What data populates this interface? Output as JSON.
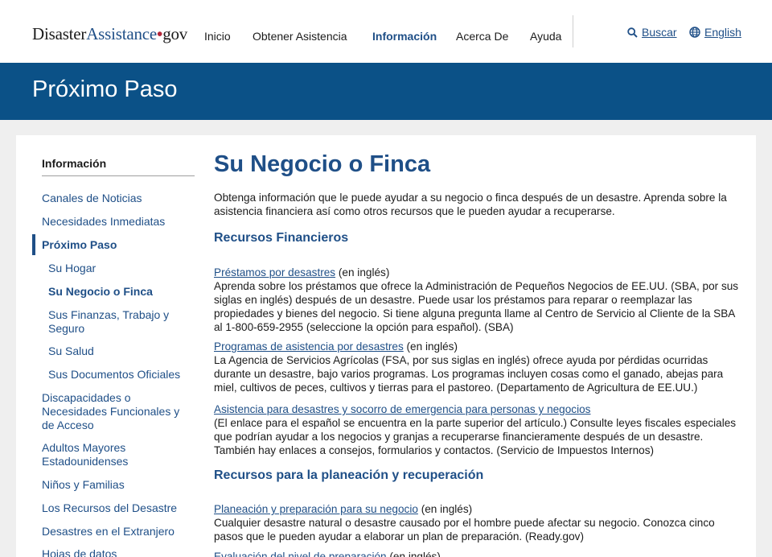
{
  "header": {
    "logo": {
      "part1": "Disaster",
      "part2": "Assistance",
      "part3": "gov"
    },
    "nav": [
      "Inicio",
      "Obtener Asistencia",
      "Información",
      "Acerca De",
      "Ayuda"
    ],
    "search_label": "Buscar",
    "language_label": "English"
  },
  "banner": {
    "title": "Próximo Paso"
  },
  "sidebar": {
    "title": "Información",
    "items": [
      {
        "label": "Canales de Noticias"
      },
      {
        "label": "Necesidades Inmediatas"
      },
      {
        "label": "Próximo Paso"
      },
      {
        "label": "Su Hogar"
      },
      {
        "label": "Su Negocio o Finca"
      },
      {
        "label": "Sus Finanzas, Trabajo y Seguro"
      },
      {
        "label": "Su Salud"
      },
      {
        "label": "Sus Documentos Oficiales"
      },
      {
        "label": "Discapacidades o Necesidades Funcionales y de Acceso"
      },
      {
        "label": "Adultos Mayores Estadounidenses"
      },
      {
        "label": "Niños y Familias"
      },
      {
        "label": "Los Recursos del Desastre"
      },
      {
        "label": "Desastres en el Extranjero"
      },
      {
        "label": "Hojas de datos"
      }
    ]
  },
  "main": {
    "title": "Su Negocio o Finca",
    "intro": "Obtenga información que le puede ayudar a su negocio o finca después de un desastre. Aprenda sobre la asistencia financiera así como otros recursos que le pueden ayudar a recuperarse.",
    "sections": [
      {
        "heading": "Recursos Financieros",
        "entries": [
          {
            "link": "Préstamos por desastres",
            "suffix": " (en inglés)",
            "text": "Aprenda sobre los préstamos que ofrece la Administración de Pequeños Negocios de EE.UU. (SBA, por sus siglas en inglés) después de un desastre. Puede usar los préstamos para reparar o reemplazar las propiedades y bienes del negocio. Si tiene alguna pregunta llame al Centro de Servicio al Cliente de la SBA al 1-800-659-2955 (seleccione la opción para español). (SBA)"
          },
          {
            "link": "Programas de asistencia por desastres",
            "suffix": " (en inglés)",
            "text": "La Agencia de Servicios Agrícolas (FSA, por sus siglas en inglés) ofrece ayuda por pérdidas ocurridas durante un desastre, bajo varios programas. Los programas incluyen cosas como el ganado, abejas para miel, cultivos de peces, cultivos y tierras para el pastoreo. (Departamento de Agricultura de EE.UU.)"
          },
          {
            "link": "Asistencia para desastres y socorro de emergencia para personas y negocios",
            "suffix": "",
            "text": "(El enlace para el español se encuentra en la parte superior del artículo.) Consulte leyes fiscales especiales que podrían ayudar a los negocios y granjas a recuperarse financieramente después de un desastre. También hay enlaces a consejos, formularios y contactos. (Servicio de Impuestos Internos)"
          }
        ]
      },
      {
        "heading": "Recursos para la planeación y recuperación",
        "entries": [
          {
            "link": "Planeación y preparación para su negocio",
            "suffix": " (en inglés)",
            "text": "Cualquier desastre natural o desastre causado por el hombre puede afectar su negocio. Conozca cinco pasos que le pueden ayudar a elaborar un plan de preparación. (Ready.gov)"
          },
          {
            "link": "Evaluación del nivel de preparación",
            "suffix": " (en inglés)",
            "text": ""
          }
        ]
      }
    ]
  },
  "colors": {
    "brand_blue": "#1f4f87",
    "banner_blue": "#0b5187",
    "logo_dot_red": "#b4283a",
    "page_bg": "#efefef"
  },
  "icons": [
    "search-icon",
    "globe-icon"
  ]
}
